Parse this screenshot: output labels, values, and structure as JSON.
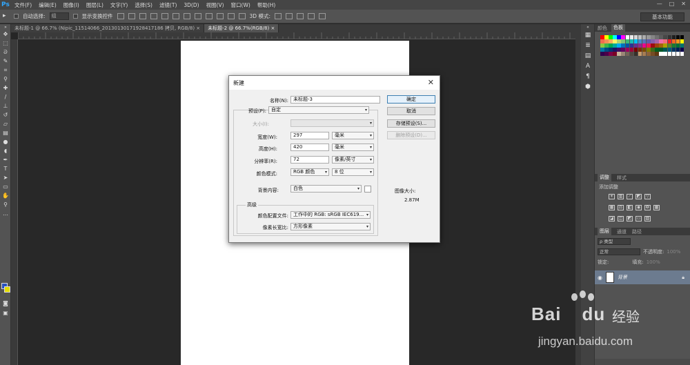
{
  "app": {
    "logo": "Ps"
  },
  "menu": [
    "文件(F)",
    "编辑(E)",
    "图像(I)",
    "图层(L)",
    "文字(Y)",
    "选择(S)",
    "滤镜(T)",
    "3D(D)",
    "视图(V)",
    "窗口(W)",
    "帮助(H)"
  ],
  "window_controls": [
    "—",
    "□",
    "✕"
  ],
  "options_bar": {
    "auto_select_label": "自动选择:",
    "auto_select_value": "组",
    "show_transform_label": "显示变换控件",
    "mode_3d_label": "3D 模式:",
    "workspace": "基本功能"
  },
  "tabs": [
    {
      "label": "未标题-1 @ 66.7% (Nipic_11514066_20130130171928417186 拷贝, RGB/8)",
      "close": "×",
      "active": false
    },
    {
      "label": "未标题-2 @ 66.7%(RGB/8)",
      "close": "×",
      "active": true
    }
  ],
  "panels": {
    "color_tabs": [
      "颜色",
      "色板"
    ],
    "adjust_tabs": [
      "调整",
      "样式"
    ],
    "adjust_title": "添加调整",
    "layer_tabs": [
      "图层",
      "通道",
      "路径"
    ],
    "kind_label": "ρ 类型",
    "blend_mode": "正常",
    "opacity_label": "不透明度:",
    "opacity_value": "100%",
    "lock_label": "锁定:",
    "fill_label": "填充:",
    "fill_value": "100%",
    "layer_name": "背景"
  },
  "dialog": {
    "title": "新建",
    "close": "✕",
    "name_label": "名称(N):",
    "name_value": "未标题-3",
    "preset_label": "预设(P):",
    "preset_value": "自定",
    "size_label": "大小(I):",
    "width_label": "宽度(W):",
    "width_value": "297",
    "width_unit": "毫米",
    "height_label": "高度(H):",
    "height_value": "420",
    "height_unit": "毫米",
    "resolution_label": "分辨率(R):",
    "resolution_value": "72",
    "resolution_unit": "像素/英寸",
    "color_mode_label": "颜色模式:",
    "color_mode_value": "RGB 颜色",
    "bit_depth": "8 位",
    "bg_label": "背景内容:",
    "bg_value": "白色",
    "advanced_label": "高级",
    "profile_label": "颜色配置文件:",
    "profile_value": "工作中的 RGB: sRGB IEC619...",
    "pixel_aspect_label": "像素长宽比:",
    "pixel_aspect_value": "方形像素",
    "ok": "确定",
    "cancel": "取消",
    "save_preset": "存储预设(S)...",
    "delete_preset": "删除预设(D)...",
    "image_size_label": "图像大小:",
    "image_size_value": "2.87M"
  },
  "watermark": {
    "brand": "Bai",
    "brand2": "du",
    "cn": "经验",
    "url": "jingyan.baidu.com"
  },
  "swatch_colors": [
    "#ff0000",
    "#ffff00",
    "#00ff00",
    "#00ffff",
    "#0000ff",
    "#ff00ff",
    "#ffffff",
    "#ebebeb",
    "#d6d6d6",
    "#c2c2c2",
    "#adadad",
    "#999999",
    "#858585",
    "#707070",
    "#5c5c5c",
    "#474747",
    "#333333",
    "#1f1f1f",
    "#0a0a0a",
    "#000000",
    "#f26c4f",
    "#f68e56",
    "#fbaf5d",
    "#fff467",
    "#acd372",
    "#7cc576",
    "#3bb878",
    "#1abbb4",
    "#00bff3",
    "#438ccb",
    "#5574b9",
    "#605ca8",
    "#855fa8",
    "#a763a8",
    "#f06ea9",
    "#f26d7d",
    "#ed1c24",
    "#f26522",
    "#f7941d",
    "#fff200",
    "#8dc73f",
    "#39b54a",
    "#00a651",
    "#00a99d",
    "#00aeef",
    "#0072bc",
    "#0054a6",
    "#2e3192",
    "#662d91",
    "#92278f",
    "#ec008c",
    "#ed145b",
    "#9e0b0f",
    "#a0410d",
    "#a36209",
    "#aba000",
    "#598527",
    "#1a7b30",
    "#007236",
    "#00746b",
    "#0076a3",
    "#004b80",
    "#003471",
    "#1b1464",
    "#440e62",
    "#630460",
    "#9e005d",
    "#9e0039",
    "#790000",
    "#7b2e00",
    "#7d4900",
    "#827b00",
    "#406618",
    "#005e20",
    "#005826",
    "#005952",
    "#005b7f",
    "#003663",
    "#002157",
    "#0d004c",
    "#32004b",
    "#4b0049",
    "#7b0046",
    "#7a0026",
    "#c7b299",
    "#998675",
    "#736357",
    "#534741",
    "#37302a",
    "#c69c6d",
    "#a67c52",
    "#8c6239",
    "#754c24",
    "#603913",
    "#ffffff",
    "#ffffff",
    "#ffffff",
    "#ffffff",
    "#ffffff",
    "#ffffff"
  ]
}
